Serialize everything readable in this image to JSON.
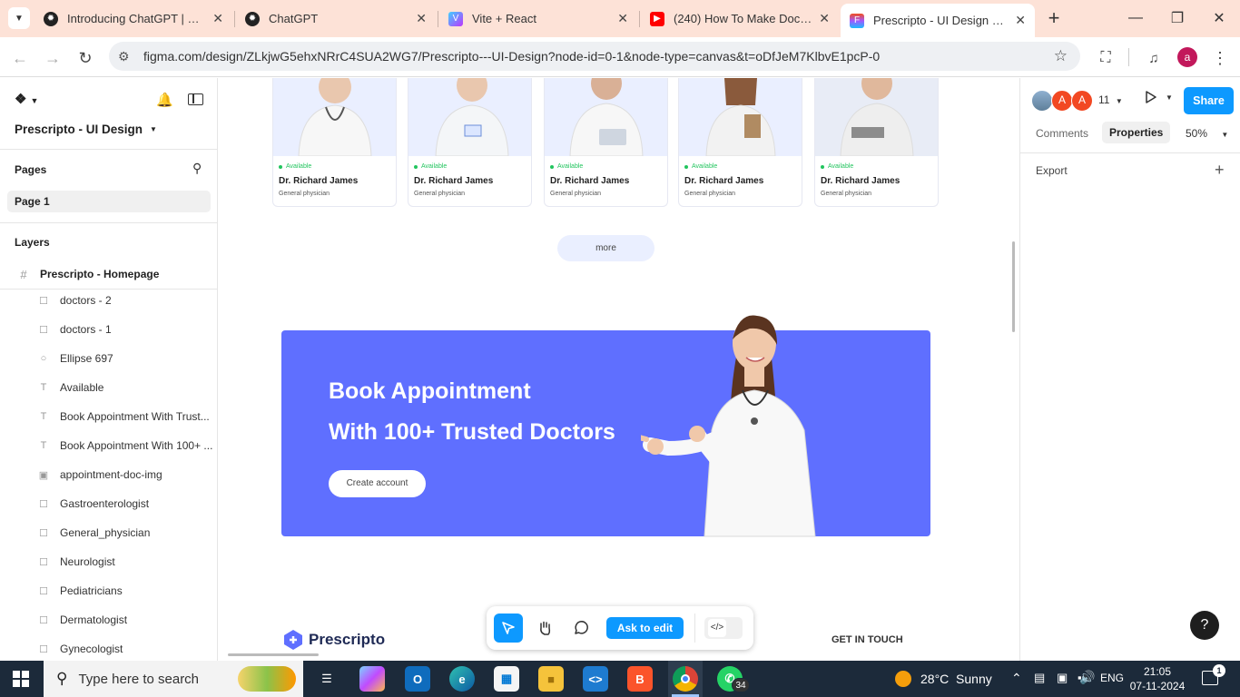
{
  "browser": {
    "tabs": [
      {
        "title": "Introducing ChatGPT | OpenAI",
        "icon": "openai-icon"
      },
      {
        "title": "ChatGPT",
        "icon": "openai-icon"
      },
      {
        "title": "Vite + React",
        "icon": "vite-icon"
      },
      {
        "title": "(240) How To Make Doctor Appointment",
        "icon": "youtube-icon"
      },
      {
        "title": "Prescripto - UI Design – Figma",
        "icon": "figma-icon",
        "active": true
      }
    ],
    "new_tab": "+",
    "url": "figma.com/design/ZLkjwG5ehxNRrC4SUA2WG7/Prescripto---UI-Design?node-id=0-1&node-type=canvas&t=oDfJeM7KlbvE1pcP-0",
    "profile_initial": "a"
  },
  "figma": {
    "file_name": "Prescripto - UI Design",
    "pages_header": "Pages",
    "current_page": "Page 1",
    "layers_header": "Layers",
    "frame": "Prescripto - Homepage",
    "layers": [
      {
        "name": "doctors - 2",
        "icon": "frame-icon"
      },
      {
        "name": "doctors - 1",
        "icon": "frame-icon"
      },
      {
        "name": "Ellipse 697",
        "icon": "ellipse-icon"
      },
      {
        "name": "Available",
        "icon": "text-icon"
      },
      {
        "name": "Book Appointment With Trust...",
        "icon": "text-icon"
      },
      {
        "name": "Book Appointment With 100+ ...",
        "icon": "text-icon"
      },
      {
        "name": "appointment-doc-img",
        "icon": "image-icon"
      },
      {
        "name": "Gastroenterologist",
        "icon": "frame-icon"
      },
      {
        "name": "General_physician",
        "icon": "frame-icon"
      },
      {
        "name": "Neurologist",
        "icon": "frame-icon"
      },
      {
        "name": "Pediatricians",
        "icon": "frame-icon"
      },
      {
        "name": "Dermatologist",
        "icon": "frame-icon"
      },
      {
        "name": "Gynecologist",
        "icon": "frame-icon"
      }
    ],
    "right": {
      "collaborators_count": "11",
      "share_label": "Share",
      "tab_comments": "Comments",
      "tab_properties": "Properties",
      "zoom": "50%",
      "export_label": "Export",
      "help_label": "?"
    },
    "toolbar": {
      "ask_to_edit": "Ask to edit"
    },
    "canvas": {
      "doctors": [
        {
          "status": "Available",
          "name": "Dr. Richard James",
          "speciality": "General physician"
        },
        {
          "status": "Available",
          "name": "Dr. Richard James",
          "speciality": "General physician"
        },
        {
          "status": "Available",
          "name": "Dr. Richard James",
          "speciality": "General physician"
        },
        {
          "status": "Available",
          "name": "Dr. Richard James",
          "speciality": "General physician"
        },
        {
          "status": "Available",
          "name": "Dr. Richard James",
          "speciality": "General physician"
        }
      ],
      "more_label": "more",
      "banner_line1": "Book Appointment",
      "banner_line2": "With 100+ Trusted Doctors",
      "banner_button": "Create account",
      "brand": "Prescripto",
      "footer_heading": "GET IN TOUCH"
    }
  },
  "taskbar": {
    "search_placeholder": "Type here to search",
    "weather": "28°C  Sunny",
    "language": "ENG",
    "time": "21:05",
    "date": "07-11-2024",
    "whatsapp_badge": "34",
    "notification_count": "1",
    "colors": {
      "taskbar": "#1c2a3a",
      "accent": "#5f6fff",
      "figma_blue": "#0d99ff"
    }
  }
}
